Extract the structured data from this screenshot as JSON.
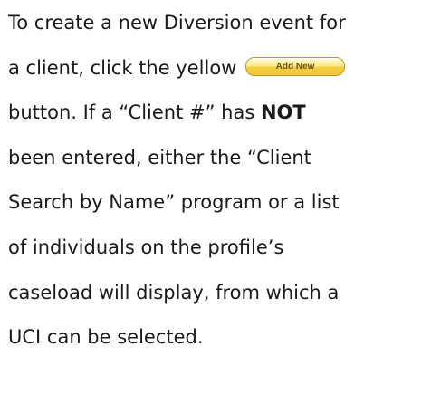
{
  "paragraph": {
    "line1": "To create a new Diversion event for",
    "line2_pre": "a client, click the yellow",
    "button_label": "Add New",
    "line3_pre": "button. If a “Client #” has ",
    "line3_bold": "NOT",
    "line4": "been entered, either the “Client",
    "line5": "Search by Name” program or a list",
    "line6": "of individuals on the profile’s",
    "line7": "caseload will display, from which a",
    "line8": "UCI can be selected."
  },
  "colors": {
    "button_fill": "#f4cf3f",
    "button_border": "#b59a2e",
    "text": "#1a1a1a"
  }
}
